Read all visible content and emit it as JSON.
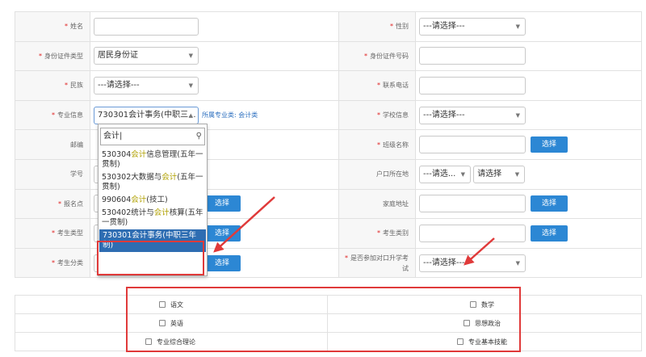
{
  "form": {
    "name_label": "姓名",
    "gender_label": "性别",
    "gender_value": "---请选择---",
    "idtype_label": "身份证件类型",
    "idtype_value": "居民身份证",
    "idnum_label": "身份证件号码",
    "ethnic_label": "民族",
    "ethnic_value": "---请选择---",
    "phone_label": "联系电话",
    "major_label": "专业信息",
    "major_value": "730301会计事务(中职三...",
    "major_hint": "所属专业类: 会计类",
    "school_label": "学校信息",
    "school_value": "---请选择---",
    "zip_label": "邮编",
    "class_label": "班级名称",
    "class_button": "选择",
    "studentno_label": "学号",
    "hukou_label": "户口所在地",
    "hukou_value1": "---请选...",
    "hukou_value2": "请选择",
    "site_label": "报名点",
    "site_button": "选择",
    "address_label": "家庭地址",
    "address_button": "选择",
    "examtype_label": "考生类型",
    "examtype_button": "选择",
    "category_label": "考生类别",
    "category_button": "选择",
    "classify_label": "考生分类",
    "classify_button": "选择",
    "dualexam_label_1": "是否参加对口升学考",
    "dualexam_label_2": "试",
    "dualexam_value": "---请选择---"
  },
  "dropdown": {
    "search_value": "会计",
    "options": [
      {
        "pre": "530304",
        "hl": "会计",
        "post": "信息管理(五年一贯制)"
      },
      {
        "pre": "530302大数据与",
        "hl": "会计",
        "post": "(五年一贯制)"
      },
      {
        "pre": "990604",
        "hl": "会计",
        "post": "(技工)"
      },
      {
        "pre": "530402统计与",
        "hl": "会计",
        "post": "核算(五年一贯制)"
      }
    ],
    "selected": "730301会计事务(中职三年制)"
  },
  "subjects": {
    "chinese": "语文",
    "math": "数学",
    "english": "英语",
    "politics": "思想政治",
    "theory": "专业综合理论",
    "skills": "专业基本技能"
  },
  "colors": {
    "accent": "#2c87d4",
    "highlight": "#e03a3a",
    "selected_option": "#2e6db2"
  }
}
